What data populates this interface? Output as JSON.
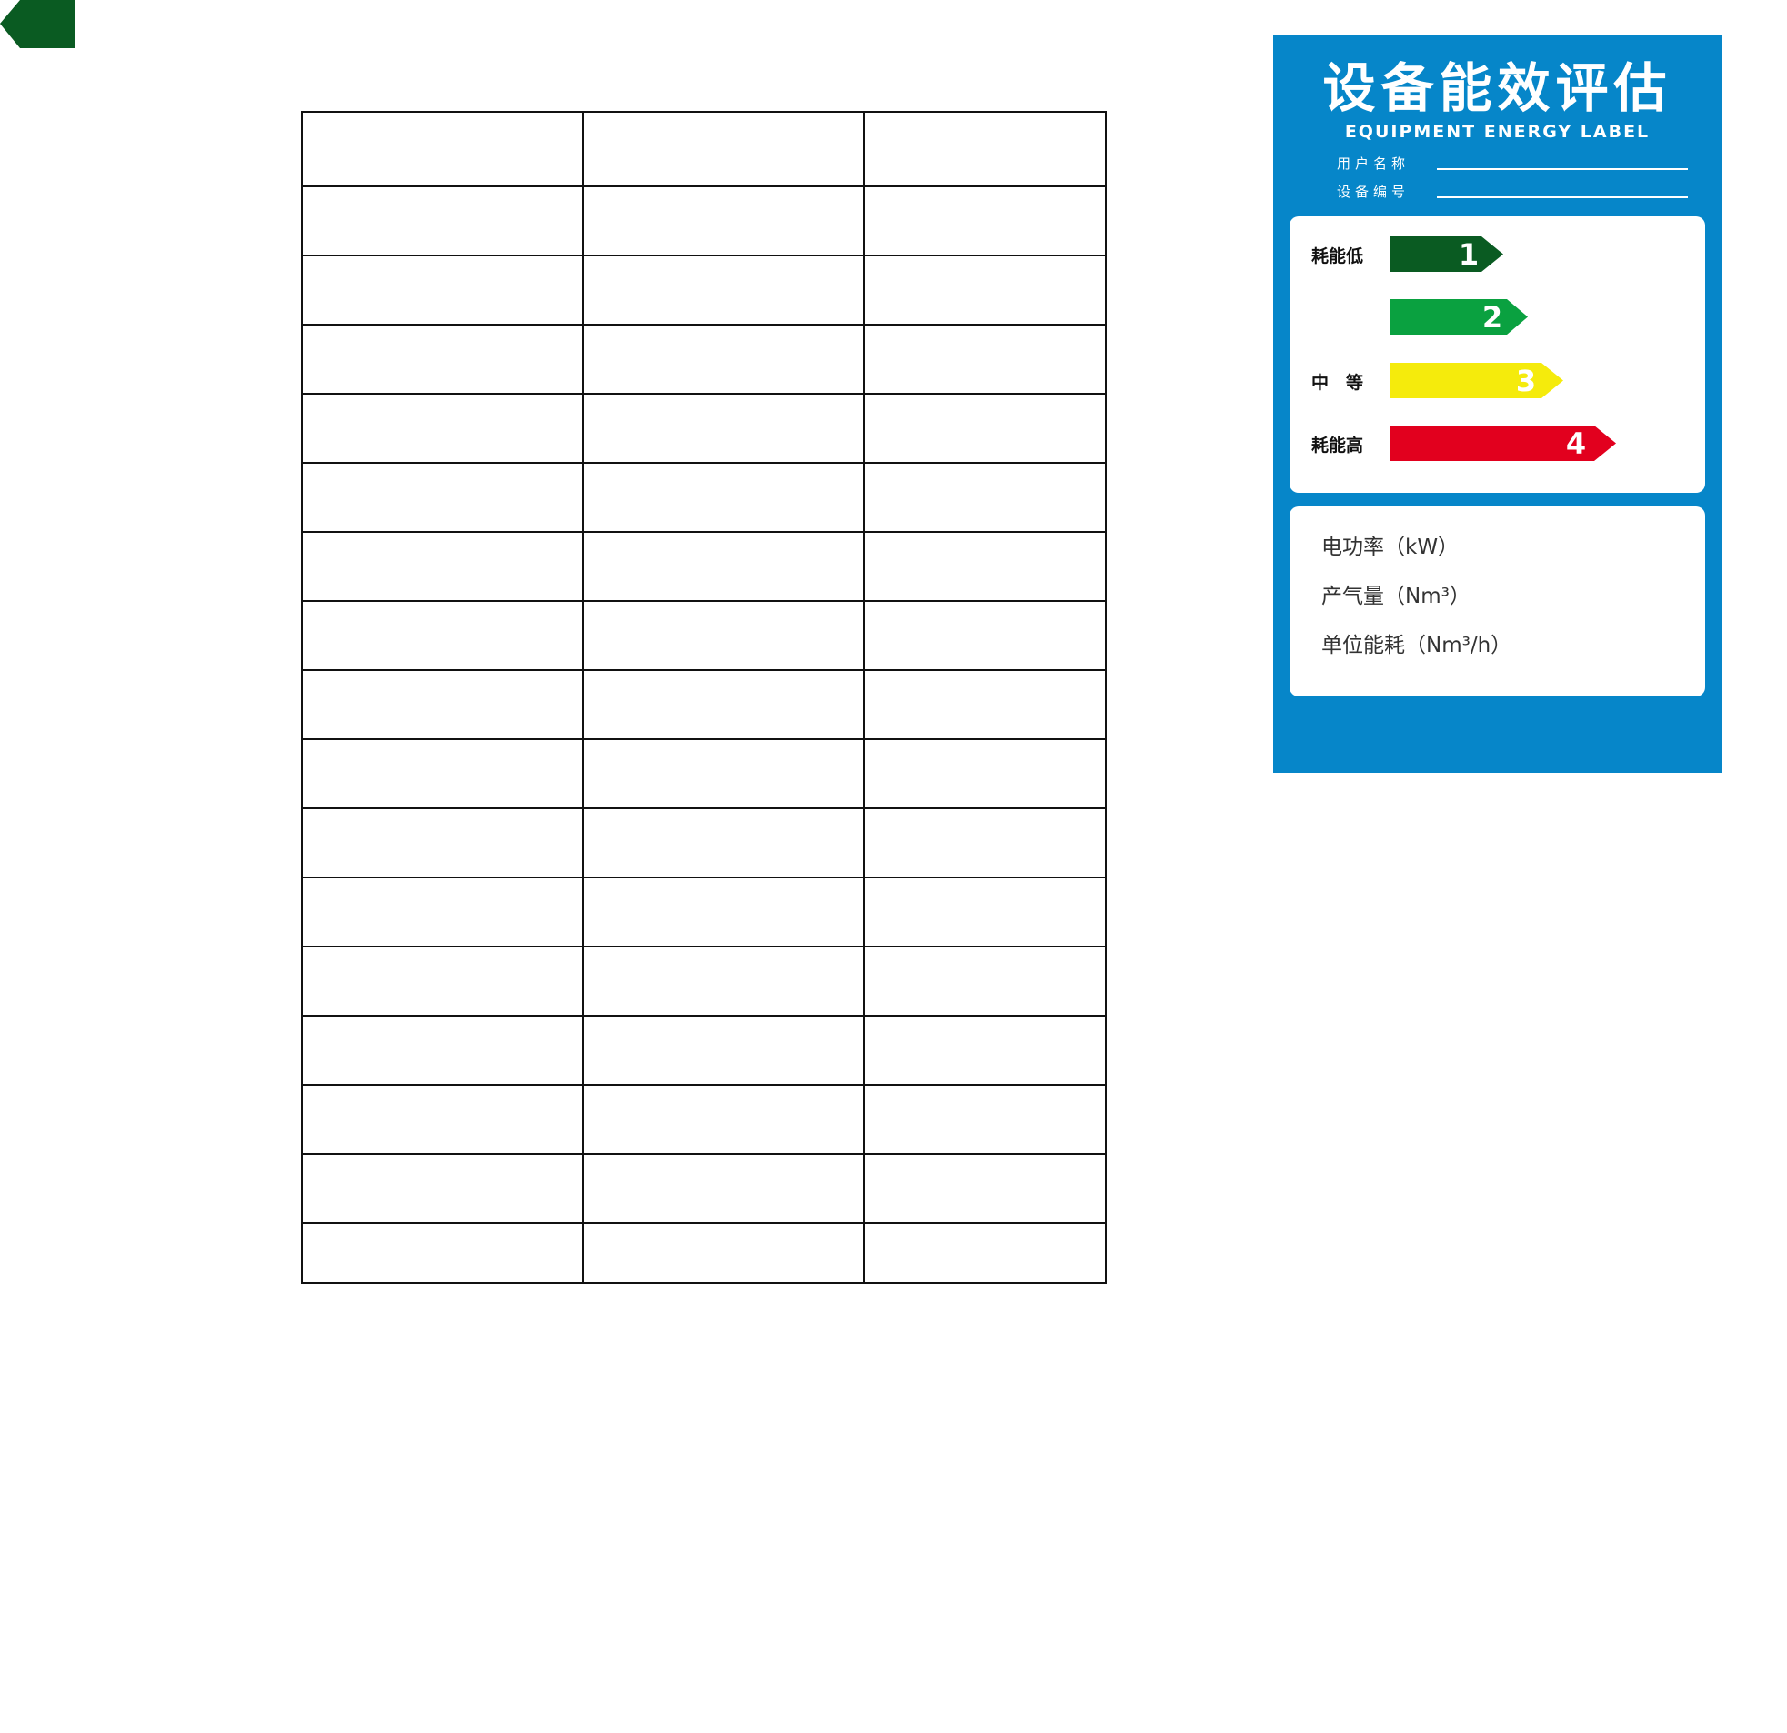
{
  "colors": {
    "card_bg": "#0686c9",
    "corner_tab": "#0a5b22",
    "grade_1": "#0a5b22",
    "grade_2": "#0aa140",
    "grade_3": "#f5eb0c",
    "grade_4": "#e2001e"
  },
  "icons": {
    "corner_tab": "left-arrow-tab-icon"
  },
  "table": {
    "rows": 17,
    "columns": 3
  },
  "label": {
    "title": "设备能效评估",
    "subtitle": "EQUIPMENT  ENERGY  LABEL",
    "user_name_label": "用户名称",
    "device_no_label": "设备编号",
    "grades": [
      {
        "caption": "耗能低",
        "number": "1"
      },
      {
        "caption": "",
        "number": "2"
      },
      {
        "caption": "中　等",
        "number": "3"
      },
      {
        "caption": "耗能高",
        "number": "4"
      }
    ],
    "info": {
      "power": "电功率（kW）",
      "gas_output": "产气量（Nm³）",
      "unit_consumption": "单位能耗（Nm³/h）"
    }
  }
}
